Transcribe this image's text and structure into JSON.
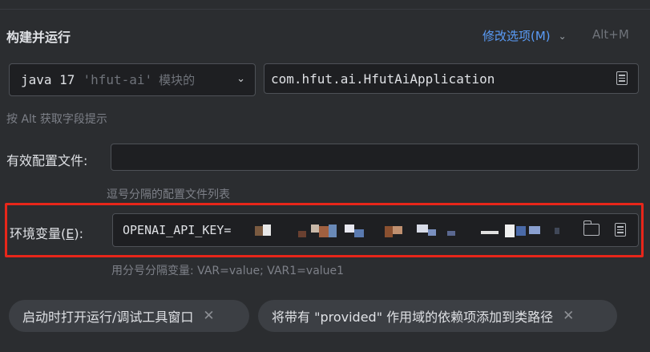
{
  "section": {
    "title": "构建并运行",
    "modify_options": "修改选项(M)",
    "modify_shortcut": "Alt+M"
  },
  "jdk": {
    "version": "java 17",
    "module": "'hfut-ai'",
    "module_suffix": "模块的"
  },
  "main_class": {
    "value": "com.hfut.ai.HfutAiApplication"
  },
  "hint_alt": "按 Alt 获取字段提示",
  "active_profiles": {
    "label": "有效配置文件:",
    "value": "",
    "hint": "逗号分隔的配置文件列表"
  },
  "env_vars": {
    "label_prefix": "环境变量(",
    "label_mnemonic": "E",
    "label_suffix": "):",
    "value_prefix": "OPENAI_API_KEY=",
    "hint": "用分号分隔变量: VAR=value; VAR1=value1"
  },
  "chips": [
    {
      "label": "启动时打开运行/调试工具窗口"
    },
    {
      "label": "将带有 \"provided\" 作用域的依赖项添加到类路径"
    }
  ],
  "icons": {
    "dropdown": "chevron-down-icon",
    "browse": "folder-icon",
    "expand": "document-lines-icon",
    "close": "close-icon"
  },
  "colors": {
    "background": "#2b2d30",
    "field_bg": "#1e1f22",
    "link": "#5a9cf8",
    "highlight_border": "#e8261a"
  }
}
